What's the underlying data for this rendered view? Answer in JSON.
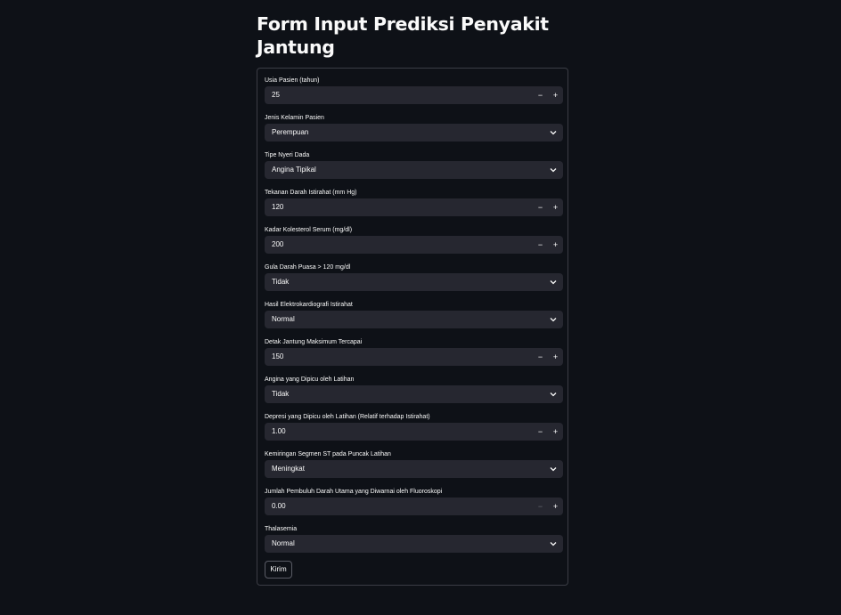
{
  "title": "Form Input Prediksi Penyakit Jantung",
  "fields": [
    {
      "label": "Usia Pasien (tahun)",
      "type": "number",
      "value": "25"
    },
    {
      "label": "Jenis Kelamin Pasien",
      "type": "select",
      "value": "Perempuan"
    },
    {
      "label": "Tipe Nyeri Dada",
      "type": "select",
      "value": "Angina Tipikal"
    },
    {
      "label": "Tekanan Darah Istirahat (mm Hg)",
      "type": "number",
      "value": "120"
    },
    {
      "label": "Kadar Kolesterol Serum (mg/dl)",
      "type": "number",
      "value": "200"
    },
    {
      "label": "Gula Darah Puasa > 120 mg/dl",
      "type": "select",
      "value": "Tidak"
    },
    {
      "label": "Hasil Elektrokardiografi Istirahat",
      "type": "select",
      "value": "Normal"
    },
    {
      "label": "Detak Jantung Maksimum Tercapai",
      "type": "number",
      "value": "150"
    },
    {
      "label": "Angina yang Dipicu oleh Latihan",
      "type": "select",
      "value": "Tidak"
    },
    {
      "label": "Depresi yang Dipicu oleh Latihan (Relatif terhadap Istirahat)",
      "type": "number",
      "value": "1.00"
    },
    {
      "label": "Kemiringan Segmen ST pada Puncak Latihan",
      "type": "select",
      "value": "Meningkat"
    },
    {
      "label": "Jumlah Pembuluh Darah Utama yang Diwarnai oleh Fluoroskopi",
      "type": "number",
      "value": "0.00",
      "minus_disabled": true
    },
    {
      "label": "Thalasemia",
      "type": "select",
      "value": "Normal"
    }
  ],
  "stepper": {
    "minus": "−",
    "plus": "+"
  },
  "submit_label": "Kirim",
  "colors": {
    "background": "#0e1117",
    "input_background": "#262730",
    "border": "#3b3d45",
    "text": "#fafafa"
  }
}
